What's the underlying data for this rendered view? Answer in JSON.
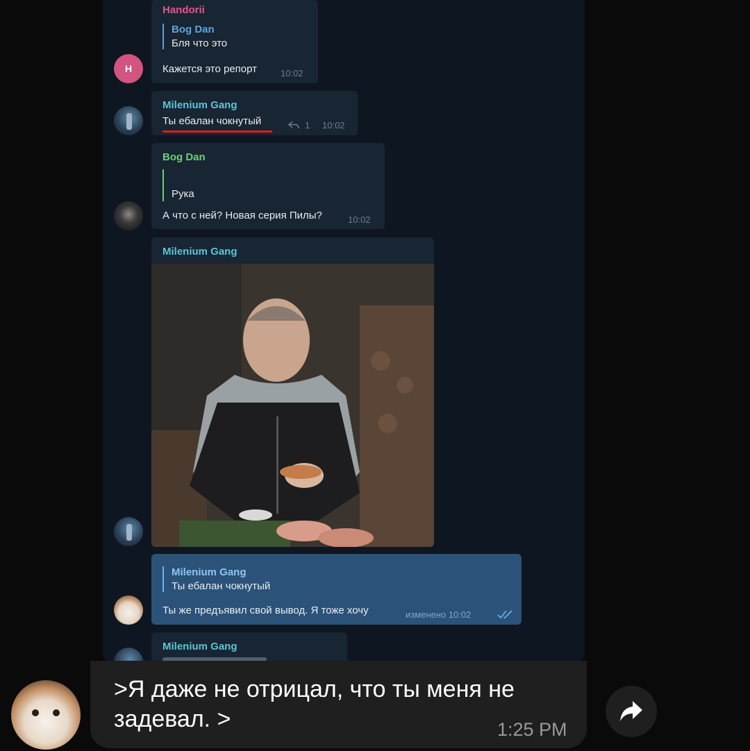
{
  "colors": {
    "chat_bg": "#0e1621",
    "incoming_bubble": "#182533",
    "outgoing_bubble": "#2b5278",
    "name_pink": "#e05790",
    "name_cyan": "#5ec3d6",
    "name_green": "#6fcf73",
    "underline_red": "#e01b1b"
  },
  "messages": [
    {
      "sender": "Handorii",
      "avatar_letter": "H",
      "reply_name": "Bog Dan",
      "reply_text": "Бля что это",
      "text": "Кажется это репорт",
      "time": "10:02"
    },
    {
      "sender": "Milenium Gang",
      "text": "Ты ебалан чокнутый",
      "reply_count": "1",
      "time": "10:02"
    },
    {
      "sender": "Bog Dan",
      "reply_text": "Рука",
      "text": "А что с ней? Новая серия Пилы?",
      "time": "10:02"
    },
    {
      "sender": "Milenium Gang"
    },
    {
      "reply_name": "Milenium Gang",
      "reply_text": "Ты ебалан чокнутый",
      "text": "Ты же предъявил свой вывод. Я тоже хочу",
      "time": "изменено 10:02"
    },
    {
      "sender": "Milenium Gang"
    }
  ],
  "comment": {
    "text": ">Я даже не отрицал, что ты меня не задевал. >",
    "time": "1:25 PM"
  },
  "icons": {
    "share": "share-arrow-icon",
    "reply": "reply-arrow-icon",
    "read": "double-check-icon"
  }
}
